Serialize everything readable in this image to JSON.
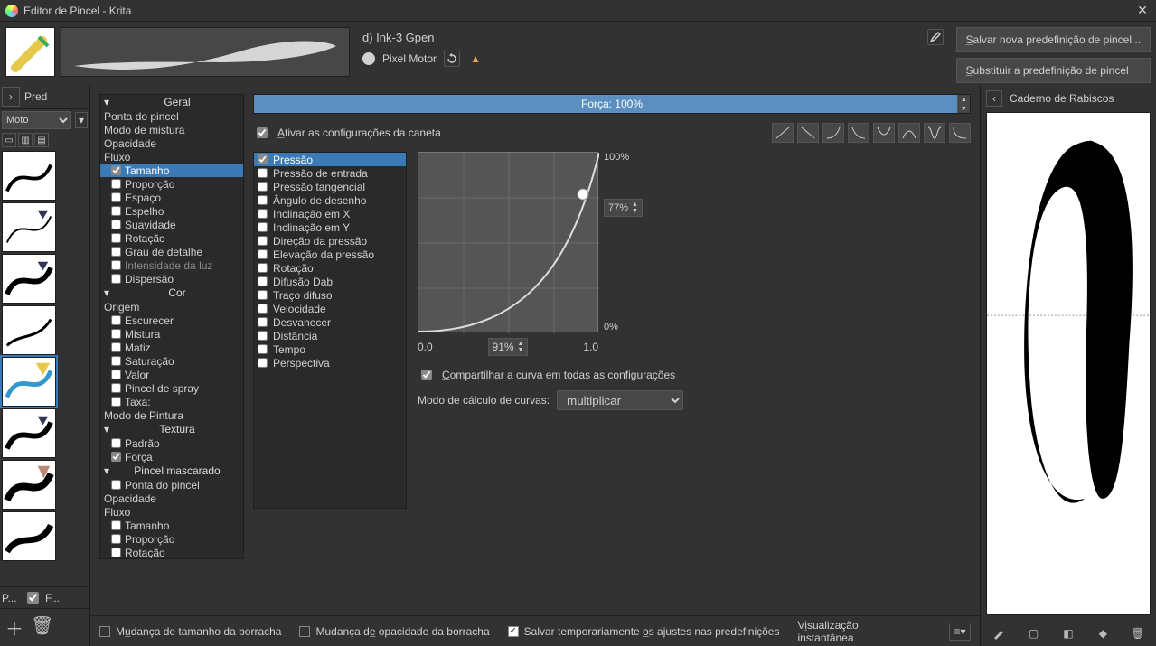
{
  "window": {
    "title": "Editor de Pincel - Krita"
  },
  "header": {
    "brush_name": "d) Ink-3 Gpen",
    "engine": "Pixel Motor",
    "save_new": "Salvar nova predefinição de pincel...",
    "overwrite": "Substituir a predefinição de pincel"
  },
  "left": {
    "presets_label": "Predefinições",
    "engines_label": "Motores",
    "presets_short": "P...",
    "filter_short": "F..."
  },
  "tree": [
    {
      "type": "grp",
      "label": "Geral"
    },
    {
      "type": "plain",
      "label": "Ponta do pincel"
    },
    {
      "type": "plain",
      "label": "Modo de mistura"
    },
    {
      "type": "plain",
      "label": "Opacidade"
    },
    {
      "type": "plain",
      "label": "Fluxo"
    },
    {
      "type": "chk",
      "label": "Tamanho",
      "checked": true,
      "sel": true
    },
    {
      "type": "chk",
      "label": "Proporção"
    },
    {
      "type": "chk",
      "label": "Espaço"
    },
    {
      "type": "chk",
      "label": "Espelho"
    },
    {
      "type": "chk",
      "label": "Suavidade"
    },
    {
      "type": "chk",
      "label": "Rotação"
    },
    {
      "type": "chk",
      "label": "Grau de detalhe"
    },
    {
      "type": "chk",
      "label": "Intensidade da luz",
      "dim": true
    },
    {
      "type": "chk",
      "label": "Dispersão"
    },
    {
      "type": "grp",
      "label": "Cor"
    },
    {
      "type": "plain",
      "label": "Origem"
    },
    {
      "type": "chk",
      "label": "Escurecer"
    },
    {
      "type": "chk",
      "label": "Mistura"
    },
    {
      "type": "chk",
      "label": "Matiz"
    },
    {
      "type": "chk",
      "label": "Saturação"
    },
    {
      "type": "chk",
      "label": "Valor"
    },
    {
      "type": "chk",
      "label": "Pincel de spray"
    },
    {
      "type": "chk",
      "label": "Taxa:"
    },
    {
      "type": "plain",
      "label": "Modo de Pintura"
    },
    {
      "type": "grp",
      "label": "Textura"
    },
    {
      "type": "chk",
      "label": "Padrão"
    },
    {
      "type": "chk",
      "label": "Força",
      "checked": true
    },
    {
      "type": "grp",
      "label": "Pincel mascarado"
    },
    {
      "type": "chk",
      "label": "Ponta do pincel"
    },
    {
      "type": "plain",
      "label": "Opacidade"
    },
    {
      "type": "plain",
      "label": "Fluxo"
    },
    {
      "type": "chk",
      "label": "Tamanho"
    },
    {
      "type": "chk",
      "label": "Proporção"
    },
    {
      "type": "chk",
      "label": "Rotação"
    }
  ],
  "settings": {
    "strength_label": "Força: 100%",
    "enable_pen": "Ativar as configurações da caneta",
    "sensors": [
      {
        "label": "Pressão",
        "checked": true,
        "sel": true
      },
      {
        "label": "Pressão de entrada"
      },
      {
        "label": "Pressão tangencial"
      },
      {
        "label": "Ângulo de desenho"
      },
      {
        "label": "Inclinação em X"
      },
      {
        "label": "Inclinação em Y"
      },
      {
        "label": "Direção da pressão"
      },
      {
        "label": "Elevação da pressão"
      },
      {
        "label": "Rotação"
      },
      {
        "label": "Difusão Dab"
      },
      {
        "label": "Traço difuso"
      },
      {
        "label": "Velocidade"
      },
      {
        "label": "Desvanecer"
      },
      {
        "label": "Distância"
      },
      {
        "label": "Tempo"
      },
      {
        "label": "Perspectiva"
      }
    ],
    "y_top": "100%",
    "y_bot": "0%",
    "x_left": "0.0",
    "x_right": "1.0",
    "x_val": "91%",
    "y_val": "77%",
    "share_curve": "Compartilhar a curva em todas as configurações",
    "calc_label": "Modo de cálculo de curvas:",
    "calc_value": "multiplicar"
  },
  "status": {
    "eraser_size": "Mudança de tamanho da borracha",
    "eraser_opacity": "Mudança de opacidade da borracha",
    "temp_save": "Salvar temporariamente os ajustes nas predefinições",
    "instant": "Visualização instantânea"
  },
  "scratch": {
    "title": "Caderno de Rabiscos"
  }
}
